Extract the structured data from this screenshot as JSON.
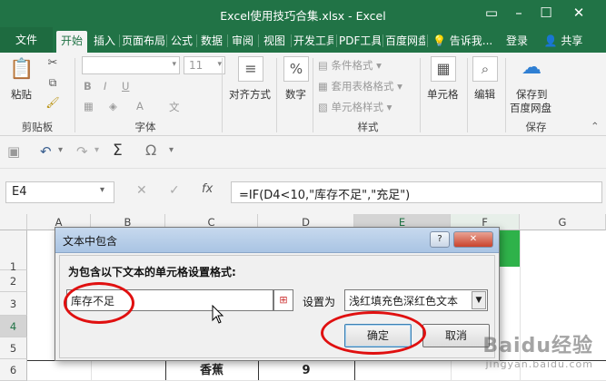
{
  "window": {
    "title": "Excel使用技巧合集.xlsx - Excel"
  },
  "tabs": [
    "文件",
    "开始",
    "插入",
    "页面布局",
    "公式",
    "数据",
    "审阅",
    "视图",
    "开发工具",
    "PDF工具",
    "百度网盘"
  ],
  "tell_me": "告诉我...",
  "login": "登录",
  "share": "共享",
  "ribbon": {
    "paste": "粘贴",
    "clipboard": "剪贴板",
    "font_group": "字体",
    "font_size": "11",
    "align": "对齐方式",
    "number": "数字",
    "cond_format": "条件格式",
    "table_format": "套用表格格式",
    "cell_style": "单元格样式",
    "style_group": "样式",
    "cells": "单元格",
    "edit": "编辑",
    "save_baidu_1": "保存到",
    "save_baidu_2": "百度网盘",
    "save_group": "保存"
  },
  "formula": {
    "name_box": "E4",
    "fx": "fx",
    "content": "=IF(D4<10,\"库存不足\",\"充足\")"
  },
  "grid": {
    "columns": [
      "A",
      "B",
      "C",
      "D",
      "E",
      "F",
      "G"
    ],
    "rows": [
      "1",
      "2",
      "3",
      "4",
      "5",
      "6"
    ],
    "row6_c": "香蕉",
    "row6_d": "9"
  },
  "dialog": {
    "title": "文本中包含",
    "instruction": "为包含以下文本的单元格设置格式:",
    "input_value": "库存不足",
    "set_as_label": "设置为",
    "format_value": "浅红填充色深红色文本",
    "ok": "确定",
    "cancel": "取消"
  },
  "watermark": {
    "main": "Baidu经验",
    "sub": "jingyan.baidu.com"
  }
}
